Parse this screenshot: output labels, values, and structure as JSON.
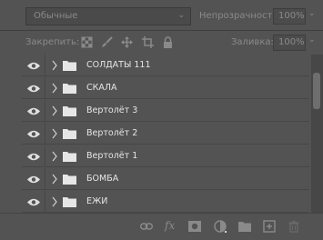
{
  "blend": {
    "mode": "Обычные"
  },
  "opacity": {
    "label": "Непрозрачность:",
    "value": "100%"
  },
  "lock": {
    "label": "Закрепить:"
  },
  "fill": {
    "label": "Заливка:",
    "value": "100%"
  },
  "layers": [
    {
      "name": "СОЛДАТЫ 111",
      "visible": true,
      "type": "folder"
    },
    {
      "name": "СКАЛА",
      "visible": true,
      "type": "folder"
    },
    {
      "name": "Вертолёт 3",
      "visible": true,
      "type": "folder"
    },
    {
      "name": "Вертолёт 2",
      "visible": true,
      "type": "folder"
    },
    {
      "name": "Вертолёт 1",
      "visible": true,
      "type": "folder"
    },
    {
      "name": "БОМБА",
      "visible": true,
      "type": "folder"
    },
    {
      "name": "ЕЖИ",
      "visible": true,
      "type": "folder"
    }
  ],
  "toolbar": {
    "icons": [
      "link-icon",
      "fx-icon",
      "mask-icon",
      "adjustment-icon",
      "group-folder-icon",
      "new-layer-icon",
      "trash-icon"
    ],
    "fx_label": "fx"
  }
}
